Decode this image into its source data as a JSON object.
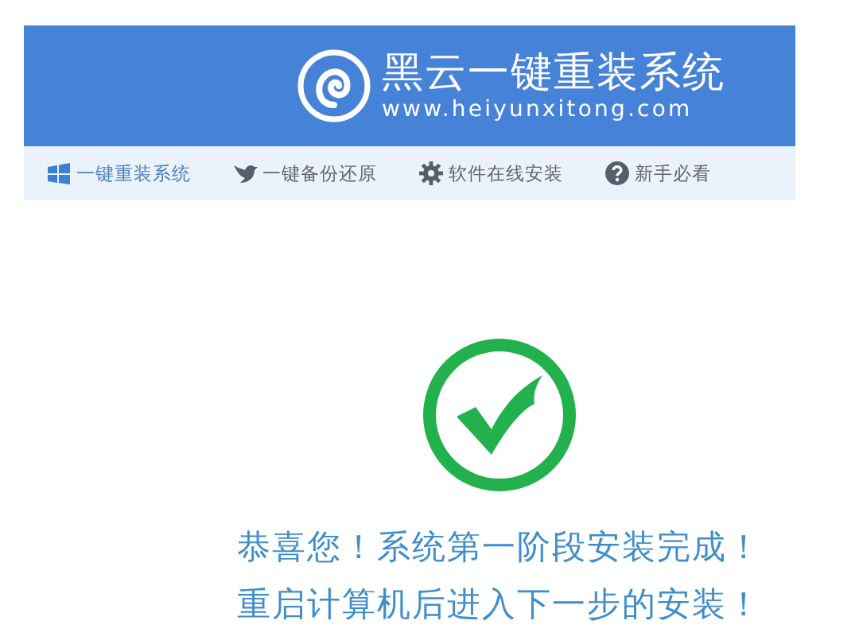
{
  "header": {
    "title": "黑云一键重装系统",
    "url": "www.heiyunxitong.com"
  },
  "nav": [
    {
      "label": "一键重装系统",
      "kind": "windows",
      "selected": true
    },
    {
      "label": "一键备份还原",
      "kind": "bird",
      "selected": false
    },
    {
      "label": "软件在线安装",
      "kind": "gear",
      "selected": false
    },
    {
      "label": "新手必看",
      "kind": "help",
      "selected": false
    }
  ],
  "message": [
    "恭喜您！系统第一阶段安装完成！",
    "重启计算机后进入下一步的安装！"
  ]
}
